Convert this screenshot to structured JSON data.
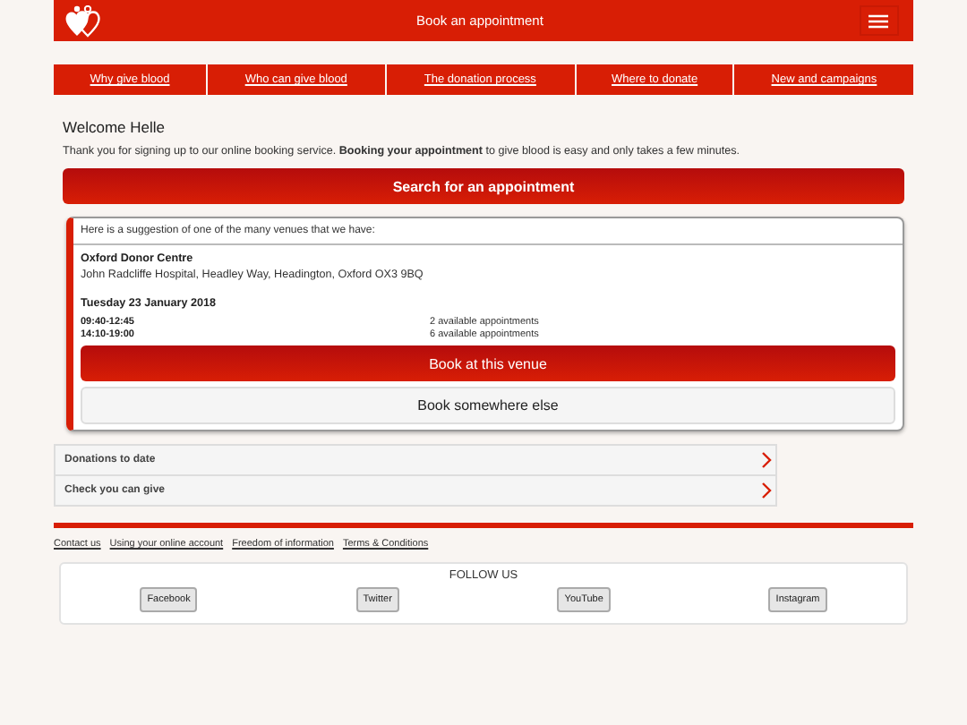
{
  "header": {
    "title": "Book an appointment"
  },
  "nav": [
    "Why give blood",
    "Who can give blood",
    "The donation process",
    "Where to donate",
    "New and campaigns"
  ],
  "welcome": "Welcome Helle",
  "intro": "Thank you for signing up to our online booking service. **Booking your appointment** to give blood is easy and only takes a few minutes.",
  "search_button": "Search for an appointment",
  "suggestion": {
    "heading": "Here is a suggestion of one of the many venues that we have:",
    "venue": "Oxford Donor Centre",
    "address": "John Radcliffe Hospital, Headley Way, Headington, Oxford OX3 9BQ",
    "date": "Tuesday 23 January 2018",
    "slots": [
      {
        "time": "09:40-12:45",
        "availability": "2 available appointments"
      },
      {
        "time": "14:10-19:00",
        "availability": "6 available appointments"
      }
    ],
    "book_button": "Book at this venue",
    "else_button": "Book somewhere else"
  },
  "panels": [
    "Donations to date",
    "Check you can give"
  ],
  "footer_links": [
    "Contact us",
    "Using your online account",
    "Freedom of information",
    "Terms & Conditions"
  ],
  "follow": {
    "title": "FOLLOW US",
    "buttons": [
      "Facebook",
      "Twitter",
      "YouTube",
      "Instagram"
    ]
  }
}
